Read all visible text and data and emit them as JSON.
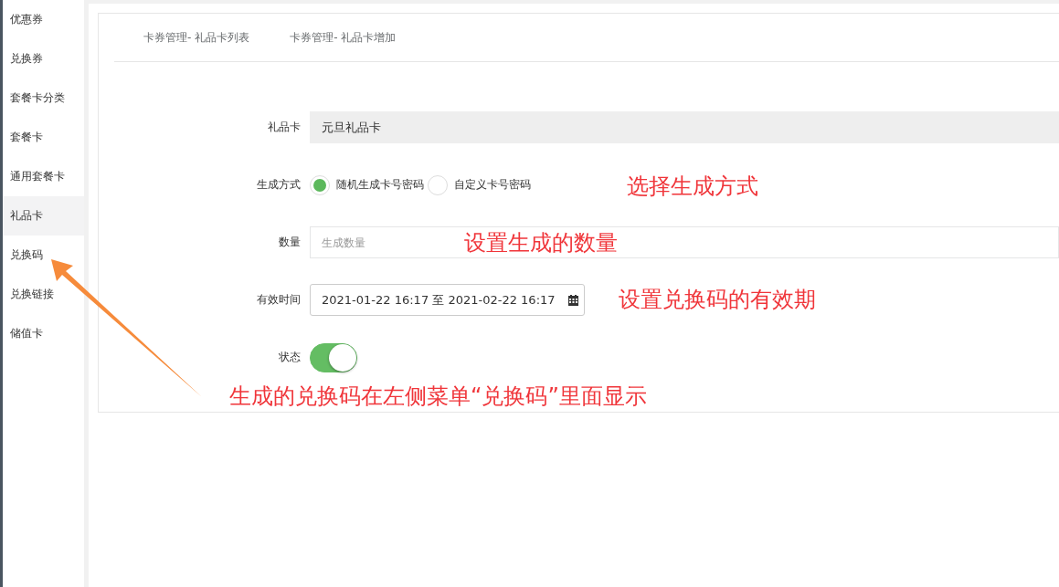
{
  "sidebar": {
    "items": [
      {
        "label": "优惠券",
        "selected": false
      },
      {
        "label": "兑换券",
        "selected": false
      },
      {
        "label": "套餐卡分类",
        "selected": false
      },
      {
        "label": "套餐卡",
        "selected": false
      },
      {
        "label": "通用套餐卡",
        "selected": false
      },
      {
        "label": "礼品卡",
        "selected": true
      },
      {
        "label": "兑换码",
        "selected": false
      },
      {
        "label": "兑换链接",
        "selected": false
      },
      {
        "label": "储值卡",
        "selected": false
      }
    ]
  },
  "tabs": [
    {
      "label": "卡券管理- 礼品卡列表",
      "selected": false
    },
    {
      "label": "卡券管理- 礼品卡增加",
      "selected": false
    }
  ],
  "form": {
    "gift_card": {
      "label": "礼品卡",
      "value": "元旦礼品卡"
    },
    "generation_method": {
      "label": "生成方式",
      "options": [
        {
          "label": "随机生成卡号密码",
          "selected": true
        },
        {
          "label": "自定义卡号密码",
          "selected": false
        }
      ]
    },
    "quantity": {
      "label": "数量",
      "placeholder": "生成数量"
    },
    "valid_time": {
      "label": "有效时间",
      "value": "2021-01-22 16:17 至 2021-02-22 16:17"
    },
    "status": {
      "label": "状态",
      "on": true
    }
  },
  "annotations": [
    "选择生成方式",
    "设置生成的数量",
    "设置兑换码的有效期",
    "生成的兑换码在左侧菜单“兑换码”里面显示"
  ]
}
